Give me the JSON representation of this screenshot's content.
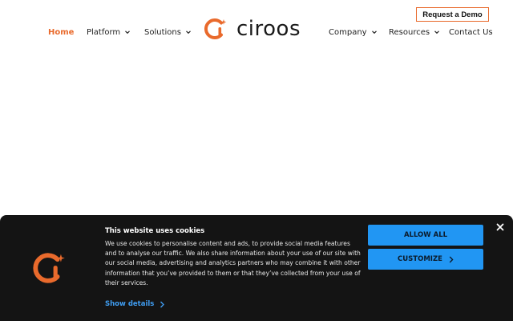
{
  "header": {
    "cta_label": "Request a Demo",
    "logo_text": "ciroos",
    "nav_left": [
      {
        "label": "Home",
        "active": true,
        "dropdown": false
      },
      {
        "label": "Platform",
        "active": false,
        "dropdown": true
      },
      {
        "label": "Solutions",
        "active": false,
        "dropdown": true
      }
    ],
    "nav_right": [
      {
        "label": "Company",
        "active": false,
        "dropdown": true
      },
      {
        "label": "Resources",
        "active": false,
        "dropdown": true
      },
      {
        "label": "Contact Us",
        "active": false,
        "dropdown": false
      }
    ]
  },
  "cookie_banner": {
    "title": "This website uses cookies",
    "body": "We use cookies to personalise content and ads, to provide social media features and to analyse our traffic. We also share information about your use of our site with our social media, advertising and analytics partners who may combine it with other information that you’ve provided to them or that they’ve collected from your use of their services.",
    "show_details_label": "Show details",
    "allow_all_label": "ALLOW ALL",
    "customize_label": "CUSTOMIZE"
  },
  "colors": {
    "brand_orange": "#e96a2c",
    "button_blue": "#2196f3",
    "banner_bg": "#141414",
    "link_blue": "#3f9cf0"
  },
  "icons": {
    "logo": "ciroos-logo-icon",
    "dropdown": "chevron-down-icon",
    "details": "chevron-right-icon",
    "close": "close-icon"
  }
}
